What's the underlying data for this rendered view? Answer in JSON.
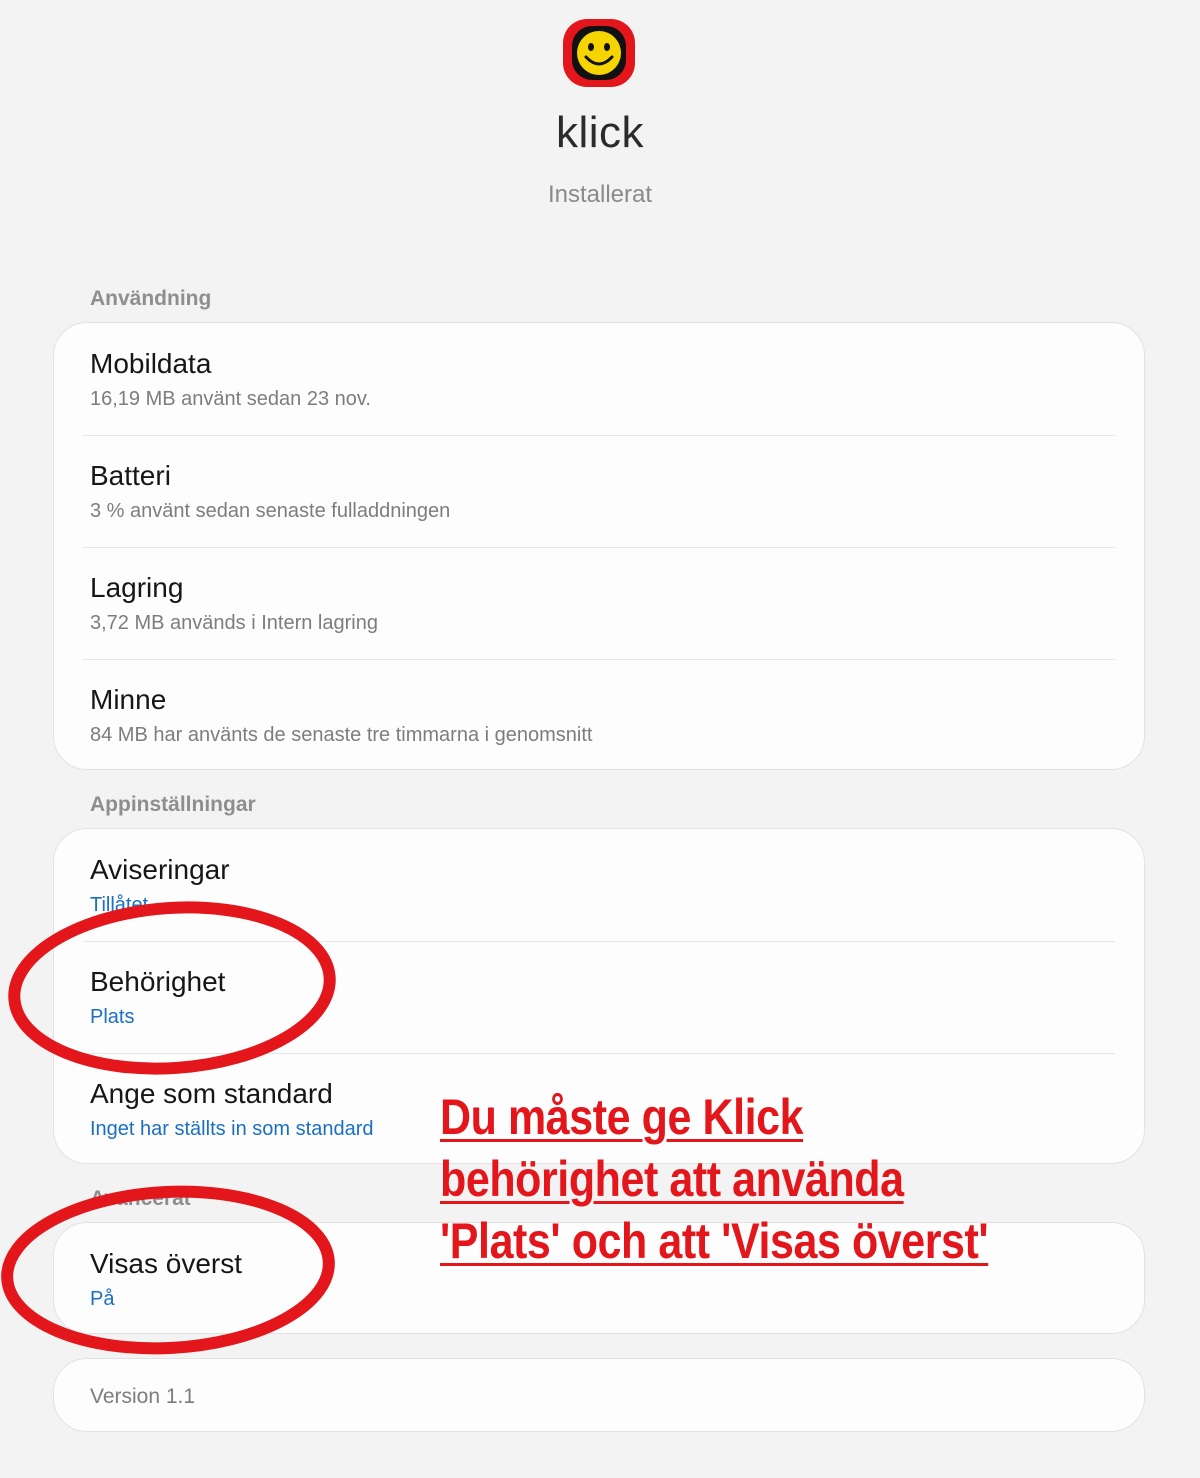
{
  "app": {
    "name": "klick",
    "status": "Installerat",
    "icon": "smiley-face-icon",
    "icon_colors": {
      "outer": "#e3161c",
      "frame": "#111111",
      "face": "#f5d400"
    }
  },
  "sections": {
    "usage": {
      "label": "Användning",
      "items": [
        {
          "title": "Mobildata",
          "subtitle": "16,19 MB använt sedan 23 nov."
        },
        {
          "title": "Batteri",
          "subtitle": "3 % använt sedan senaste fulladdningen"
        },
        {
          "title": "Lagring",
          "subtitle": "3,72 MB används i Intern lagring"
        },
        {
          "title": "Minne",
          "subtitle": "84 MB har använts de senaste tre timmarna i genomsnitt"
        }
      ]
    },
    "app_settings": {
      "label": "Appinställningar",
      "items": [
        {
          "title": "Aviseringar",
          "subtitle": "Tillåtet"
        },
        {
          "title": "Behörighet",
          "subtitle": "Plats"
        },
        {
          "title": "Ange som standard",
          "subtitle": "Inget har ställts in som standard"
        }
      ]
    },
    "advanced": {
      "label": "Avancerat",
      "items": [
        {
          "title": "Visas överst",
          "subtitle": "På"
        }
      ]
    }
  },
  "version": "Version 1.1",
  "annotation": {
    "lines": [
      "Du måste ge Klick",
      "behörighet att använda",
      "'Plats' och att 'Visas överst'"
    ],
    "color": "#e3161c"
  },
  "colors": {
    "background": "#f3f3f3",
    "card": "#fdfdfd",
    "link_blue": "#1a6fc4",
    "secondary_text": "#7d7d7d"
  }
}
